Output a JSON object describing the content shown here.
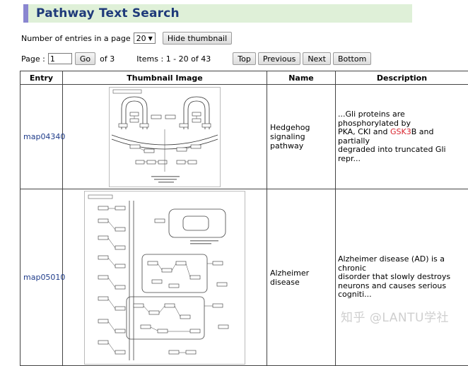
{
  "header": {
    "title": "Pathway Text Search"
  },
  "controls": {
    "entries_label": "Number of entries in a page",
    "entries_value": "20",
    "hide_thumbnail_label": "Hide thumbnail",
    "page_label": "Page :",
    "page_value": "1",
    "go_label": "Go",
    "of_pages": "of 3",
    "items_label": "Items : 1 - 20 of 43",
    "nav": {
      "top": "Top",
      "previous": "Previous",
      "next": "Next",
      "bottom": "Bottom"
    }
  },
  "table": {
    "headers": {
      "entry": "Entry",
      "thumbnail": "Thumbnail Image",
      "name": "Name",
      "description": "Description"
    },
    "rows": [
      {
        "entry": "map04340",
        "name_line1": "Hedgehog",
        "name_line2": "signaling pathway",
        "desc_line1": "...Gli proteins are phosphorylated by",
        "desc_line2_pre": "PKA, CKI and ",
        "desc_line2_highlight": "GSK3",
        "desc_line2_post": "B and partially",
        "desc_line3": "degraded into truncated Gli repr..."
      },
      {
        "entry": "map05010",
        "name": "Alzheimer disease",
        "desc_line1": "Alzheimer disease (AD) is a chronic",
        "desc_line2": "disorder that slowly destroys",
        "desc_line3": "neurons and causes serious",
        "desc_line4": "cogniti..."
      }
    ]
  },
  "watermark": "知乎 @LANTU学社",
  "colors": {
    "title_text": "#1f3a7a",
    "title_bg": "#dff0d8",
    "title_accent": "#8a86d0",
    "link": "#1f3c8a",
    "highlight": "#d9232d"
  }
}
